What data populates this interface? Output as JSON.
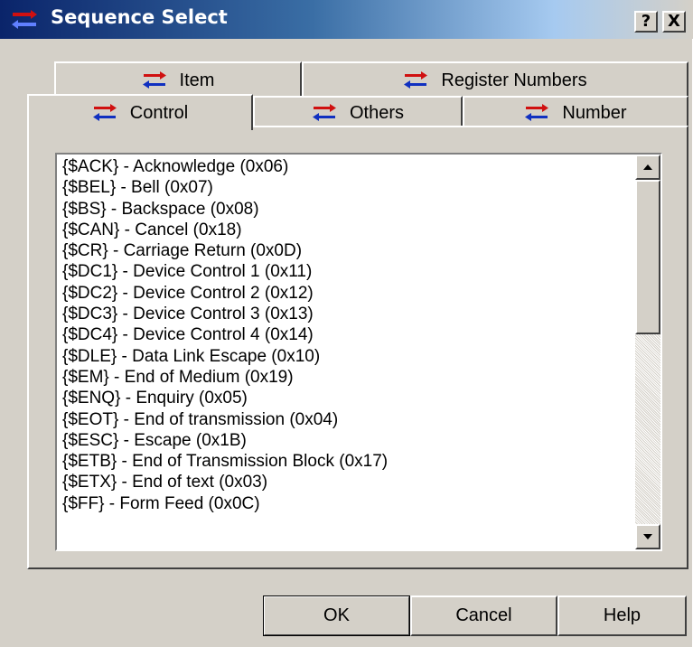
{
  "window": {
    "title": "Sequence Select",
    "help_button": "?",
    "close_button": "X"
  },
  "tabs": {
    "row1": [
      {
        "label": "Item",
        "icon": "sequence-arrows-icon"
      },
      {
        "label": "Register Numbers",
        "icon": "sequence-arrows-icon"
      }
    ],
    "row2": [
      {
        "label": "Control",
        "icon": "sequence-arrows-icon",
        "selected": true
      },
      {
        "label": "Others",
        "icon": "sequence-arrows-icon"
      },
      {
        "label": "Number",
        "icon": "sequence-arrows-icon"
      }
    ]
  },
  "list": {
    "items": [
      "{$ACK} - Acknowledge (0x06)",
      "{$BEL} - Bell (0x07)",
      "{$BS} - Backspace (0x08)",
      "{$CAN} - Cancel (0x18)",
      "{$CR} - Carriage Return (0x0D)",
      "{$DC1} - Device Control 1 (0x11)",
      "{$DC2} - Device Control 2 (0x12)",
      "{$DC3} - Device Control 3 (0x13)",
      "{$DC4} - Device Control 4 (0x14)",
      "{$DLE} - Data Link Escape (0x10)",
      "{$EM} - End of Medium (0x19)",
      "{$ENQ} - Enquiry (0x05)",
      "{$EOT} - End of transmission (0x04)",
      "{$ESC} - Escape (0x1B)",
      "{$ETB} - End of Transmission Block (0x17)",
      "{$ETX} - End of text (0x03)",
      "{$FF} - Form Feed (0x0C)"
    ],
    "scroll_position": 0,
    "scroll_visible_fraction": 0.45
  },
  "buttons": {
    "ok": "OK",
    "cancel": "Cancel",
    "help": "Help"
  },
  "colors": {
    "title_gradient_start": "#0a246a",
    "title_gradient_end": "#a6caf0",
    "face": "#d4d0c8",
    "icon_red": "#d01010",
    "icon_blue": "#1030c0"
  }
}
